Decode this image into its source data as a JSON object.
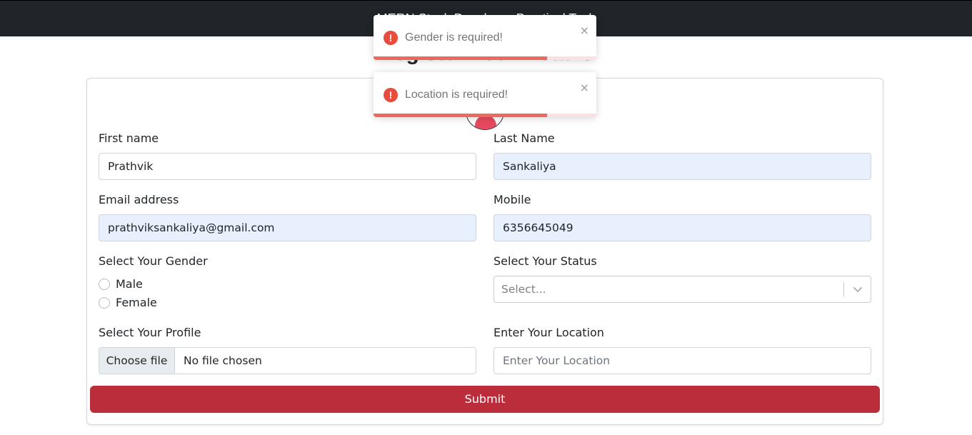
{
  "navbar": {
    "brand": "MERN Stack Developer Practical Task"
  },
  "page": {
    "heading": "Register Your Details"
  },
  "form": {
    "first_name": {
      "label": "First name",
      "value": "Prathvik"
    },
    "last_name": {
      "label": "Last Name",
      "value": "Sankaliya"
    },
    "email": {
      "label": "Email address",
      "value": "prathviksankaliya@gmail.com"
    },
    "mobile": {
      "label": "Mobile",
      "value": "6356645049"
    },
    "gender": {
      "label": "Select Your Gender",
      "options": [
        "Male",
        "Female"
      ]
    },
    "status": {
      "label": "Select Your Status",
      "placeholder": "Select..."
    },
    "profile": {
      "label": "Select Your Profile",
      "button": "Choose file",
      "value": "No file chosen"
    },
    "location": {
      "label": "Enter Your Location",
      "placeholder": "Enter Your Location"
    },
    "submit_label": "Submit"
  },
  "toasts": [
    {
      "message": "Gender is required!",
      "progress": 0.78,
      "icon": "exclamation-icon",
      "close": "×"
    },
    {
      "message": "Location is required!",
      "progress": 0.78,
      "icon": "exclamation-icon",
      "close": "×"
    }
  ],
  "colors": {
    "navbar": "#212529",
    "submit": "#bb2d3b",
    "autofill": "#e8f0fe",
    "toast_error": "#e74c3c"
  }
}
